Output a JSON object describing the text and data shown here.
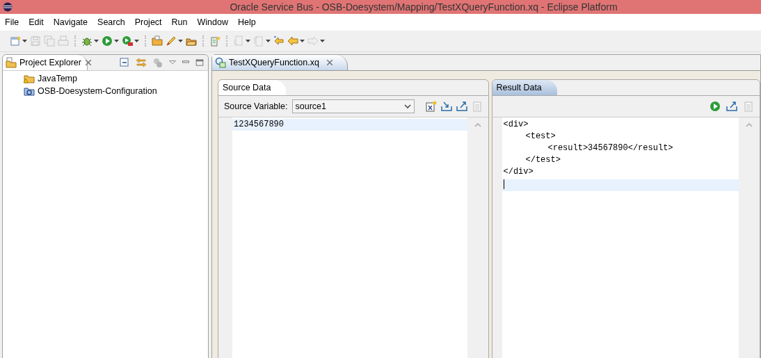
{
  "window": {
    "title": "Oracle Service Bus - OSB-Doesystem/Mapping/TestXQueryFunction.xq - Eclipse Platform"
  },
  "menu": [
    "File",
    "Edit",
    "Navigate",
    "Search",
    "Project",
    "Run",
    "Window",
    "Help"
  ],
  "toolbar": [
    [
      {
        "kind": "new",
        "disabled": false
      },
      {
        "kind": "caret"
      },
      {
        "kind": "save",
        "disabled": true
      },
      {
        "kind": "save-all",
        "disabled": true
      },
      {
        "kind": "print",
        "disabled": true
      }
    ],
    [
      {
        "kind": "debug",
        "disabled": false
      },
      {
        "kind": "caret"
      },
      {
        "kind": "run",
        "disabled": false
      },
      {
        "kind": "caret"
      },
      {
        "kind": "external",
        "disabled": false
      },
      {
        "kind": "caret"
      }
    ],
    [
      {
        "kind": "folder",
        "disabled": false
      },
      {
        "kind": "pen",
        "disabled": false
      },
      {
        "kind": "caret"
      },
      {
        "kind": "open",
        "disabled": false
      }
    ],
    [
      {
        "kind": "task",
        "disabled": false
      }
    ],
    [
      {
        "kind": "next-annotation",
        "disabled": true
      },
      {
        "kind": "caret"
      },
      {
        "kind": "prev-annotation",
        "disabled": true
      },
      {
        "kind": "caret"
      },
      {
        "kind": "last-edit",
        "disabled": false
      },
      {
        "kind": "back",
        "disabled": false
      },
      {
        "kind": "caret"
      },
      {
        "kind": "forward",
        "disabled": true
      },
      {
        "kind": "caret"
      }
    ]
  ],
  "project_explorer": {
    "title": "Project Explorer",
    "items": [
      {
        "label": "JavaTemp",
        "kind": "java-project"
      },
      {
        "label": "OSB-Doesystem-Configuration",
        "kind": "osb-project"
      }
    ]
  },
  "editor": {
    "tab": "TestXQueryFunction.xq",
    "source": {
      "title": "Source Data",
      "variable_label": "Source Variable:",
      "variable_value": "source1",
      "lines": [
        {
          "text": "1234567890",
          "current": true
        }
      ]
    },
    "result": {
      "title": "Result Data",
      "lines": [
        {
          "text": "<div>",
          "current": false,
          "children": [
            {
              "text": "<test>",
              "current": false,
              "children": [
                {
                  "text": "<result>34567890</result>",
                  "current": false
                }
              ]
            },
            {
              "text": "</test>",
              "current": false
            }
          ]
        },
        {
          "text": "</div>",
          "current": false
        }
      ],
      "cursor_line": true
    }
  }
}
